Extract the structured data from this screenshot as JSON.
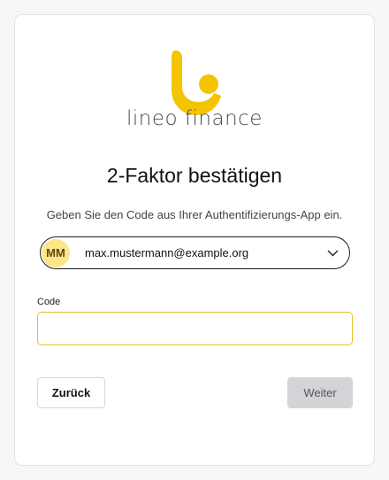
{
  "brand": {
    "name": "lineo finance",
    "color": "#f5c400"
  },
  "page": {
    "title": "2-Faktor bestätigen",
    "subtitle": "Geben Sie den Code aus Ihrer Authentifizierungs-App ein."
  },
  "account": {
    "initials": "MM",
    "email": "max.mustermann@example.org",
    "icon": "chevron-down-icon"
  },
  "code": {
    "label": "Code",
    "value": "",
    "placeholder": ""
  },
  "actions": {
    "back_label": "Zurück",
    "next_label": "Weiter"
  },
  "colors": {
    "accent": "#e4c12a",
    "avatar_bg": "#fde68a",
    "disabled_button": "#d4d4d8"
  }
}
